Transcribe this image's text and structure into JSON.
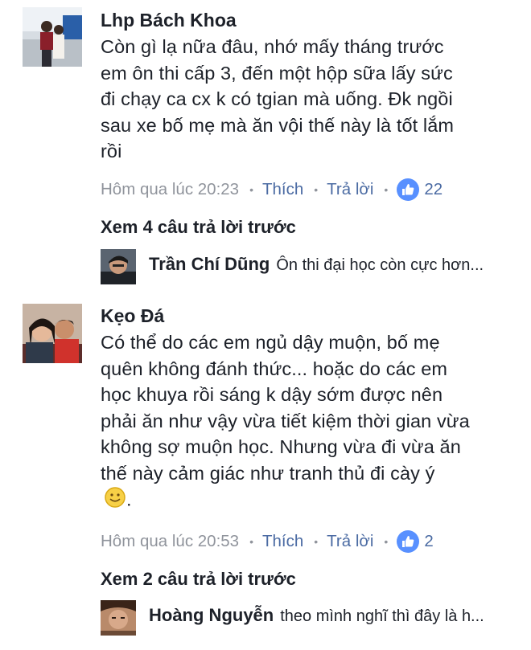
{
  "comments": [
    {
      "author": "Lhp Bách Khoa",
      "lines": [
        "Còn gì lạ nữa đâu, nhớ mấy tháng trước",
        "em ôn thi cấp 3, đến một hộp sữa lấy sức",
        "đi chạy ca cx k có tgian mà uống. Đk ngồi",
        "sau xe bố mẹ mà ăn vội thế này là tốt lắm",
        "rồi"
      ],
      "time": "Hôm qua lúc 20:23",
      "like_label": "Thích",
      "reply_label": "Trả lời",
      "like_count": "22",
      "see_more": "Xem 4 câu trả lời trước",
      "reply": {
        "author": "Trần Chí Dũng",
        "text": "Ôn thi đại học còn cực hơn..."
      }
    },
    {
      "author": "Kẹo Đá",
      "lines": [
        "Có thể do các em ngủ dậy muộn, bố mẹ",
        "quên không đánh thức... hoặc do các em",
        "học khuya rồi sáng k dậy sớm được nên",
        "phải ăn như vậy vừa tiết kiệm thời gian vừa",
        "không sợ muộn học. Nhưng vừa đi vừa ăn",
        "thế này cảm giác như tranh thủ đi cày ý"
      ],
      "last_line_suffix": ".",
      "time": "Hôm qua lúc 20:53",
      "like_label": "Thích",
      "reply_label": "Trả lời",
      "like_count": "2",
      "see_more": "Xem 2 câu trả lời trước",
      "reply": {
        "author": "Hoàng Nguyễn",
        "text": "theo mình nghĩ thì đây là h..."
      }
    }
  ],
  "icons": {
    "like": "thumbs-up-icon",
    "emoji": "slightly-smiling-face-icon"
  },
  "colors": {
    "link": "#4b6ba3",
    "meta": "#90949c",
    "like_badge": "#5890ff",
    "text": "#1d2129"
  }
}
